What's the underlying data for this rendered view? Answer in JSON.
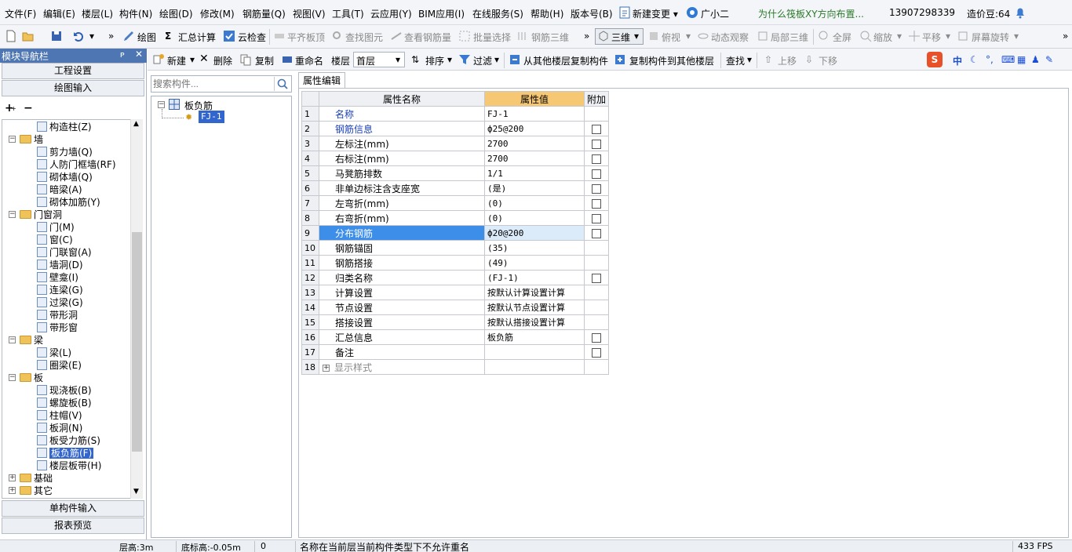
{
  "menu": [
    "文件(F)",
    "编辑(E)",
    "楼层(L)",
    "构件(N)",
    "绘图(D)",
    "修改(M)",
    "钢筋量(Q)",
    "视图(V)",
    "工具(T)",
    "云应用(Y)",
    "BIM应用(I)",
    "在线服务(S)",
    "帮助(H)",
    "版本号(B)"
  ],
  "menu_extra": {
    "new_change": "新建变更 ▾",
    "assistant": "广小二",
    "question": "为什么筏板XY方向布置...",
    "phone": "13907298339",
    "beans": "造价豆:64"
  },
  "toolbar": [
    "绘图",
    "汇总计算",
    "云检查",
    "平齐板顶",
    "查找图元",
    "查看钢筋量",
    "批量选择",
    "钢筋三维",
    "三维",
    "俯视",
    "动态观察",
    "局部三维",
    "全屏",
    "缩放",
    "平移",
    "屏幕旋转"
  ],
  "nav": {
    "title": "模块导航栏",
    "top_buttons": [
      "工程设置",
      "绘图输入"
    ],
    "bottom_buttons": [
      "单构件输入",
      "报表预览"
    ],
    "tree": [
      {
        "label": "构造柱(Z)",
        "level": 2
      },
      {
        "label": "墙",
        "level": 1,
        "folder": true
      },
      {
        "label": "剪力墙(Q)",
        "level": 2
      },
      {
        "label": "人防门框墙(RF)",
        "level": 2
      },
      {
        "label": "砌体墙(Q)",
        "level": 2
      },
      {
        "label": "暗梁(A)",
        "level": 2
      },
      {
        "label": "砌体加筋(Y)",
        "level": 2
      },
      {
        "label": "门窗洞",
        "level": 1,
        "folder": true
      },
      {
        "label": "门(M)",
        "level": 2
      },
      {
        "label": "窗(C)",
        "level": 2
      },
      {
        "label": "门联窗(A)",
        "level": 2
      },
      {
        "label": "墙洞(D)",
        "level": 2
      },
      {
        "label": "壁龛(I)",
        "level": 2
      },
      {
        "label": "连梁(G)",
        "level": 2
      },
      {
        "label": "过梁(G)",
        "level": 2
      },
      {
        "label": "带形洞",
        "level": 2
      },
      {
        "label": "带形窗",
        "level": 2
      },
      {
        "label": "梁",
        "level": 1,
        "folder": true
      },
      {
        "label": "梁(L)",
        "level": 2
      },
      {
        "label": "圈梁(E)",
        "level": 2
      },
      {
        "label": "板",
        "level": 1,
        "folder": true
      },
      {
        "label": "现浇板(B)",
        "level": 2
      },
      {
        "label": "螺旋板(B)",
        "level": 2
      },
      {
        "label": "柱帽(V)",
        "level": 2
      },
      {
        "label": "板洞(N)",
        "level": 2
      },
      {
        "label": "板受力筋(S)",
        "level": 2
      },
      {
        "label": "板负筋(F)",
        "level": 2,
        "selected": true
      },
      {
        "label": "楼层板带(H)",
        "level": 2
      },
      {
        "label": "基础",
        "level": 1,
        "folder": true,
        "collapsed": true
      },
      {
        "label": "其它",
        "level": 1,
        "folder": true,
        "collapsed": true
      }
    ]
  },
  "comp_toolbar": {
    "new": "新建",
    "delete": "删除",
    "copy": "复制",
    "rename": "重命名",
    "floor_label": "楼层",
    "floor_value": "首层",
    "sort": "排序",
    "filter": "过滤",
    "copy_from": "从其他楼层复制构件",
    "copy_to": "复制构件到其他楼层",
    "find": "查找",
    "up": "上移",
    "down": "下移"
  },
  "search": {
    "placeholder": "搜索构件..."
  },
  "comp_tree": {
    "root": "板负筋",
    "child": "FJ-1"
  },
  "ime": {
    "lang": "中"
  },
  "props": {
    "tab": "属性编辑",
    "headers": [
      "属性名称",
      "属性值",
      "附加"
    ],
    "rows": [
      {
        "n": "1",
        "name": "名称",
        "value": "FJ-1",
        "blue": true,
        "cb": false
      },
      {
        "n": "2",
        "name": "钢筋信息",
        "value": "ф25@200",
        "blue": true,
        "cb": true
      },
      {
        "n": "3",
        "name": "左标注(mm)",
        "value": "2700",
        "blue": false,
        "cb": true
      },
      {
        "n": "4",
        "name": "右标注(mm)",
        "value": "2700",
        "blue": false,
        "cb": true
      },
      {
        "n": "5",
        "name": "马凳筋排数",
        "value": "1/1",
        "blue": false,
        "cb": true
      },
      {
        "n": "6",
        "name": "非单边标注含支座宽",
        "value": "(是)",
        "blue": false,
        "cb": true
      },
      {
        "n": "7",
        "name": "左弯折(mm)",
        "value": "(0)",
        "blue": false,
        "cb": true
      },
      {
        "n": "8",
        "name": "右弯折(mm)",
        "value": "(0)",
        "blue": false,
        "cb": true
      },
      {
        "n": "9",
        "name": "分布钢筋",
        "value": "ф20@200",
        "blue": false,
        "cb": true,
        "sel": true
      },
      {
        "n": "10",
        "name": "钢筋锚固",
        "value": "(35)",
        "blue": false,
        "cb": false
      },
      {
        "n": "11",
        "name": "钢筋搭接",
        "value": "(49)",
        "blue": false,
        "cb": false
      },
      {
        "n": "12",
        "name": "归类名称",
        "value": "(FJ-1)",
        "blue": false,
        "cb": true
      },
      {
        "n": "13",
        "name": "计算设置",
        "value": "按默认计算设置计算",
        "blue": false,
        "cb": false
      },
      {
        "n": "14",
        "name": "节点设置",
        "value": "按默认节点设置计算",
        "blue": false,
        "cb": false
      },
      {
        "n": "15",
        "name": "搭接设置",
        "value": "按默认搭接设置计算",
        "blue": false,
        "cb": false
      },
      {
        "n": "16",
        "name": "汇总信息",
        "value": "板负筋",
        "blue": false,
        "cb": true
      },
      {
        "n": "17",
        "name": "备注",
        "value": "",
        "blue": false,
        "cb": true
      },
      {
        "n": "18",
        "name": "显示样式",
        "value": "",
        "blue": false,
        "cb": false,
        "expander": true
      }
    ]
  },
  "status": {
    "floor_height": "层高:3m",
    "base_height": "底标高:-0.05m",
    "count": "0",
    "message": "名称在当前层当前构件类型下不允许重名",
    "fps": "433 FPS"
  }
}
